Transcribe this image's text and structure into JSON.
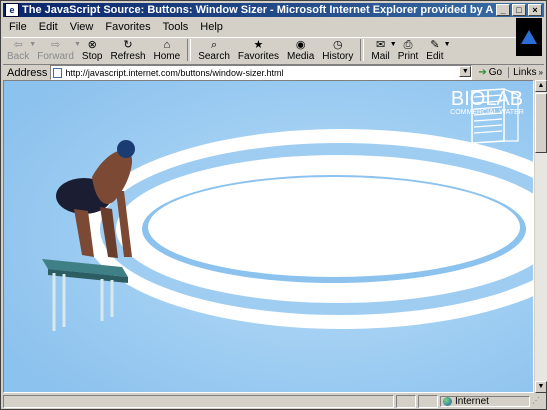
{
  "window": {
    "title": "The JavaScript Source: Buttons: Window Sizer - Microsoft Internet Explorer provided by America Online",
    "buttons": [
      "_",
      "□",
      "×"
    ]
  },
  "menu": [
    {
      "label": "File"
    },
    {
      "label": "Edit"
    },
    {
      "label": "View"
    },
    {
      "label": "Favorites"
    },
    {
      "label": "Tools"
    },
    {
      "label": "Help"
    }
  ],
  "toolbar": {
    "buttons": [
      {
        "label": "Back",
        "icon": "back-arrow-icon",
        "enabled": false
      },
      {
        "label": "Forward",
        "icon": "forward-arrow-icon",
        "enabled": false
      },
      {
        "label": "Stop",
        "icon": "stop-icon",
        "enabled": true
      },
      {
        "label": "Refresh",
        "icon": "refresh-icon",
        "enabled": true
      },
      {
        "label": "Home",
        "icon": "home-icon",
        "enabled": true
      },
      {
        "label": "Search",
        "icon": "search-icon",
        "enabled": true
      },
      {
        "label": "Favorites",
        "icon": "favorites-icon",
        "enabled": true
      },
      {
        "label": "Media",
        "icon": "media-icon",
        "enabled": true
      },
      {
        "label": "History",
        "icon": "history-icon",
        "enabled": true
      },
      {
        "label": "Mail",
        "icon": "mail-icon",
        "enabled": true
      },
      {
        "label": "Print",
        "icon": "print-icon",
        "enabled": true
      },
      {
        "label": "Edit",
        "icon": "edit-icon",
        "enabled": true
      }
    ]
  },
  "address": {
    "label": "Address",
    "url": "http://javascript.internet.com/buttons/window-sizer.html",
    "go_label": "Go",
    "links_label": "Links"
  },
  "page": {
    "logo_name": "BIOLAB",
    "logo_sub": "COMMERCIAL WATER",
    "background": "#9fcdf2"
  },
  "status": {
    "text": "",
    "zone": "Internet"
  },
  "colors": {
    "titlebar_start": "#0a246a",
    "titlebar_end": "#3a6ea5",
    "chrome": "#d4d0c8"
  }
}
